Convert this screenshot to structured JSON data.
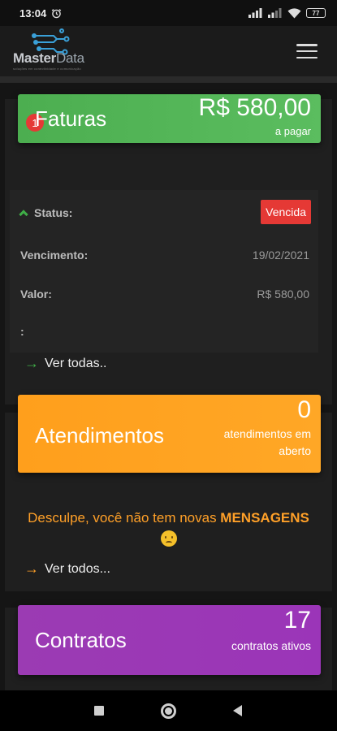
{
  "status_bar": {
    "time": "13:04",
    "battery": "77"
  },
  "app": {
    "logo_primary": "Master",
    "logo_secondary": "Data",
    "logo_tagline": "soluções em conectividade e comunicação"
  },
  "faturas": {
    "title": "Faturas",
    "badge": "1",
    "amount": "R$ 580,00",
    "amount_caption": "a pagar",
    "status_label": "Status:",
    "status_value": "Vencida",
    "vencimento_label": "Vencimento:",
    "vencimento_value": "19/02/2021",
    "valor_label": "Valor:",
    "valor_value": "R$ 580,00",
    "extra_label": ":",
    "link": "Ver todas.."
  },
  "atendimentos": {
    "title": "Atendimentos",
    "count": "0",
    "caption_1": "atendimentos em",
    "caption_2": "aberto",
    "message_prefix": "Desculpe, você não tem novas ",
    "message_highlight": "MENSAGENS",
    "link": "Ver todos..."
  },
  "contratos": {
    "title": "Contratos",
    "count": "17",
    "caption": "contratos ativos"
  },
  "colors": {
    "faturas": "#4cae50",
    "atendimentos": "#ffa726",
    "contratos": "#9b35b8",
    "alert": "#e53935"
  },
  "icons": [
    "alarm-icon",
    "signal-icon",
    "wifi-icon",
    "battery-icon",
    "menu-icon",
    "chevron-up-icon",
    "arrow-right-icon",
    "sad-face-icon",
    "nav-recent-icon",
    "nav-home-icon",
    "nav-back-icon"
  ]
}
